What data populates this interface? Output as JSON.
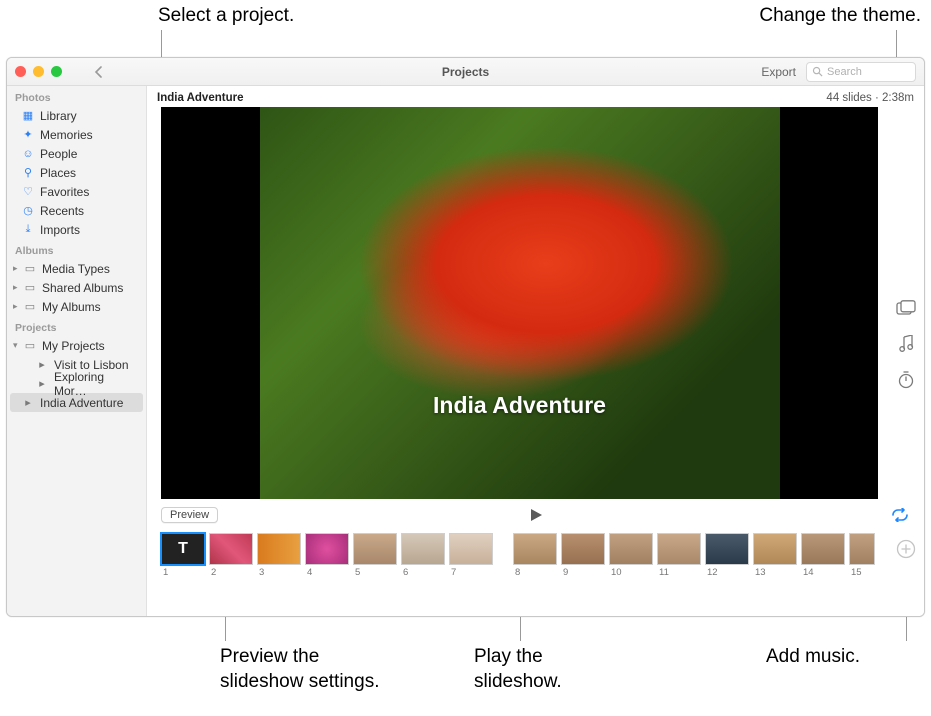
{
  "callouts": {
    "select_project": "Select a project.",
    "change_theme": "Change the theme.",
    "preview_slideshow": "Preview the\nslideshow settings.",
    "play_slideshow": "Play the\nslideshow.",
    "add_music": "Add music."
  },
  "titlebar": {
    "title": "Projects",
    "export": "Export",
    "search_placeholder": "Search"
  },
  "sidebar": {
    "sections": {
      "photos": "Photos",
      "albums": "Albums",
      "projects": "Projects"
    },
    "photos": {
      "library": "Library",
      "memories": "Memories",
      "people": "People",
      "places": "Places",
      "favorites": "Favorites",
      "recents": "Recents",
      "imports": "Imports"
    },
    "albums": {
      "media_types": "Media Types",
      "shared": "Shared Albums",
      "my_albums": "My Albums"
    },
    "projects": {
      "group": "My Projects",
      "visit": "Visit to Lisbon",
      "exploring": "Exploring Mor…",
      "india": "India Adventure"
    }
  },
  "project": {
    "name": "India Adventure",
    "stats": "44 slides · 2:38m",
    "caption": "India Adventure"
  },
  "controls": {
    "preview": "Preview"
  },
  "thumbs": [
    "1",
    "2",
    "3",
    "4",
    "5",
    "6",
    "7",
    "8",
    "9",
    "10",
    "11",
    "12",
    "13",
    "14",
    "15"
  ],
  "thumb_title_glyph": "T"
}
